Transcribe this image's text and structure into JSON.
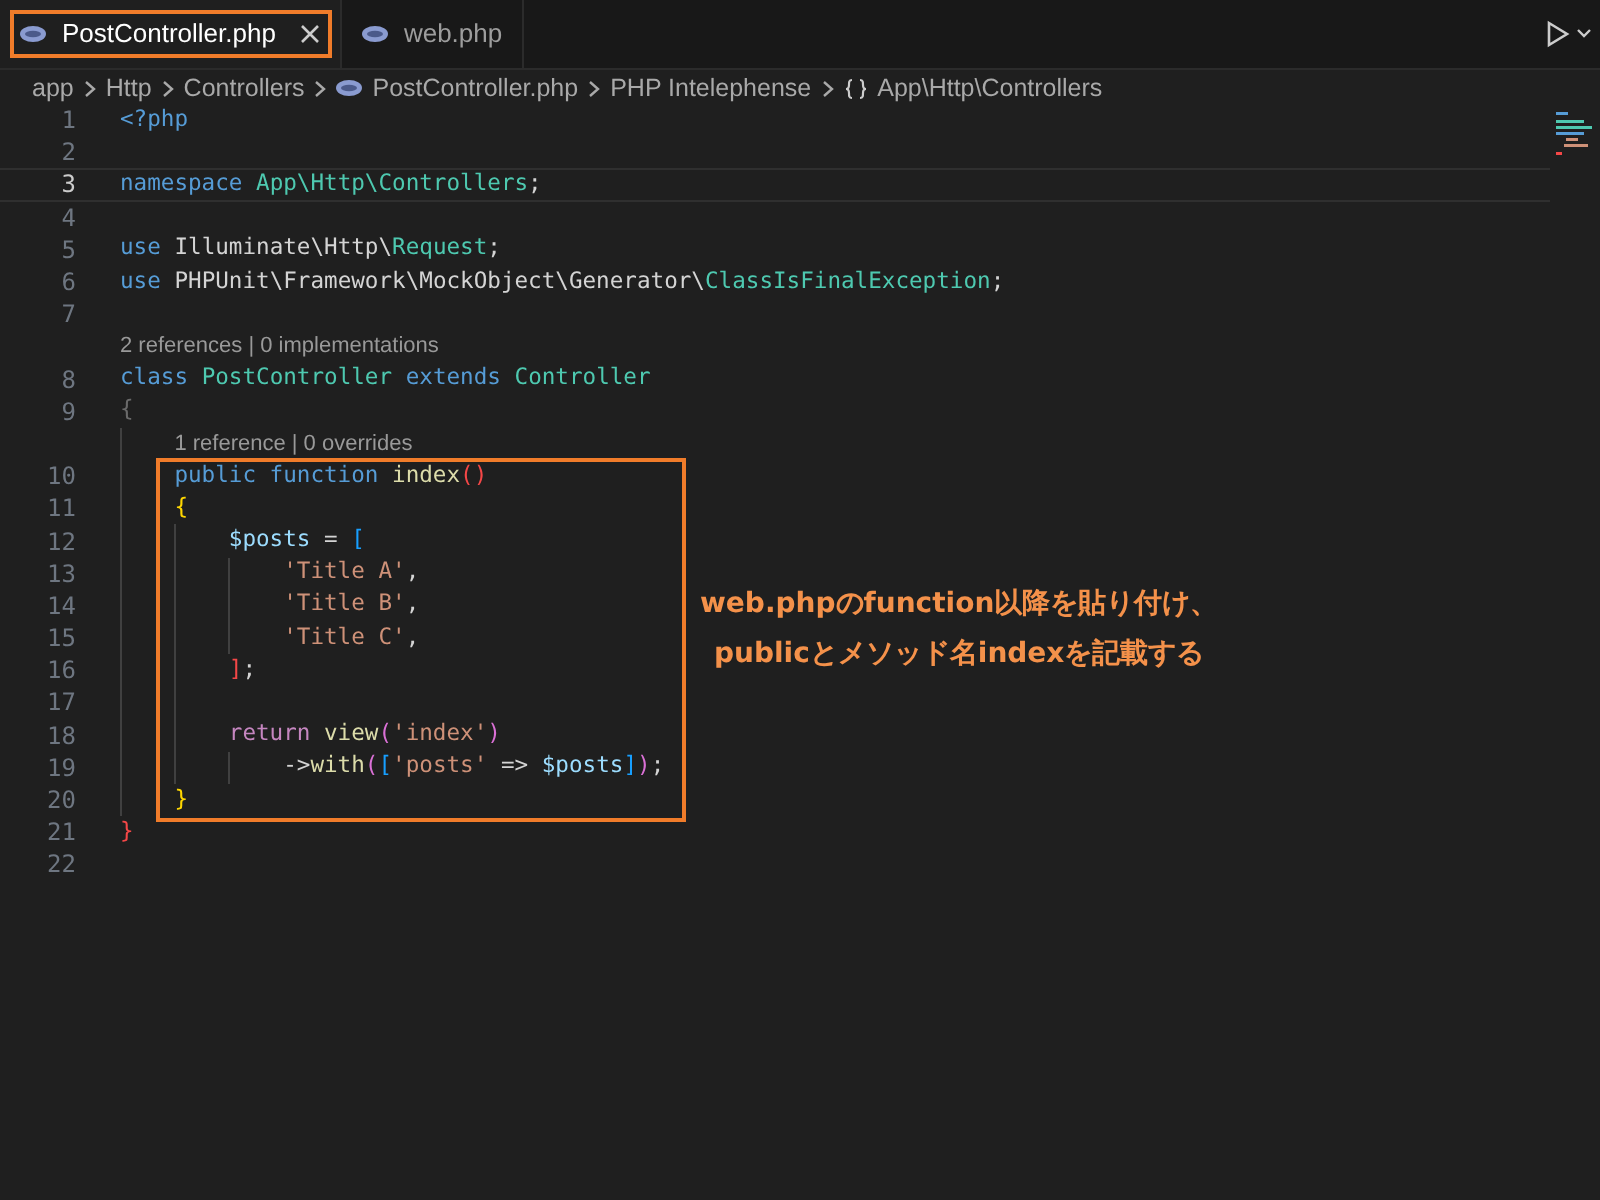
{
  "tabs": [
    {
      "label": "PostController.php",
      "selected": true
    },
    {
      "label": "web.php",
      "selected": false
    }
  ],
  "breadcrumb": [
    {
      "text": "app",
      "kind": "folder"
    },
    {
      "text": "Http",
      "kind": "folder"
    },
    {
      "text": "Controllers",
      "kind": "folder"
    },
    {
      "text": "PostController.php",
      "kind": "file"
    },
    {
      "text": "PHP Intelephense",
      "kind": "folder"
    },
    {
      "text": "App\\Http\\Controllers",
      "kind": "namespace"
    }
  ],
  "lines": [
    {
      "kind": "code",
      "number": "1",
      "tokens": [
        {
          "t": "<?php",
          "kind": "kw"
        }
      ]
    },
    {
      "kind": "code",
      "number": "2"
    },
    {
      "kind": "code",
      "number": "3",
      "current": true,
      "tokens": [
        {
          "t": "namespace ",
          "kind": "kw"
        },
        {
          "t": "App\\Http\\Controllers",
          "kind": "type"
        },
        {
          "t": ";",
          "kind": "plain"
        }
      ]
    },
    {
      "kind": "code",
      "number": "4"
    },
    {
      "kind": "code",
      "number": "5",
      "tokens": [
        {
          "t": "use ",
          "kind": "kw"
        },
        {
          "t": "Illuminate\\Http\\",
          "kind": "plain"
        },
        {
          "t": "Request",
          "kind": "type"
        },
        {
          "t": ";",
          "kind": "plain"
        }
      ]
    },
    {
      "kind": "code",
      "number": "6",
      "tokens": [
        {
          "t": "use ",
          "kind": "kw"
        },
        {
          "t": "PHPUnit\\Framework\\MockObject\\Generator\\",
          "kind": "plain"
        },
        {
          "t": "ClassIsFinalException",
          "kind": "type"
        },
        {
          "t": ";",
          "kind": "plain"
        }
      ]
    },
    {
      "kind": "code",
      "number": "7"
    },
    {
      "kind": "lens",
      "text": "2 references | 0 implementations"
    },
    {
      "kind": "code",
      "number": "8",
      "tokens": [
        {
          "t": "class ",
          "kind": "kw"
        },
        {
          "t": "PostController ",
          "kind": "type"
        },
        {
          "t": "extends ",
          "kind": "kw"
        },
        {
          "t": "Controller",
          "kind": "type"
        }
      ]
    },
    {
      "kind": "code",
      "number": "9",
      "tokens": [
        {
          "t": "{",
          "kind": "dim"
        }
      ],
      "children": [
        {
          "kind": "lens",
          "text": "1 reference | 0 overrides"
        },
        {
          "kind": "frame",
          "children": [
            {
              "kind": "code",
              "number": "10",
              "tokens": [
                {
                  "t": "public ",
                  "kind": "kw"
                },
                {
                  "t": "function ",
                  "kind": "kw"
                },
                {
                  "t": "index",
                  "kind": "fn"
                },
                {
                  "t": "()",
                  "kind": "red"
                }
              ]
            },
            {
              "kind": "code",
              "number": "11",
              "tokens": [
                {
                  "t": "{",
                  "kind": "gold"
                }
              ],
              "children": [
                {
                  "kind": "code",
                  "number": "12",
                  "tokens": [
                    {
                      "t": "$posts",
                      "kind": "var"
                    },
                    {
                      "t": " = ",
                      "kind": "plain"
                    },
                    {
                      "t": "[",
                      "kind": "blue"
                    }
                  ],
                  "children": [
                    {
                      "kind": "code",
                      "number": "13",
                      "tokens": [
                        {
                          "t": "'Title A'",
                          "kind": "str"
                        },
                        {
                          "t": ",",
                          "kind": "plain"
                        }
                      ]
                    },
                    {
                      "kind": "code",
                      "number": "14",
                      "tokens": [
                        {
                          "t": "'Title B'",
                          "kind": "str"
                        },
                        {
                          "t": ",",
                          "kind": "plain"
                        }
                      ]
                    },
                    {
                      "kind": "code",
                      "number": "15",
                      "tokens": [
                        {
                          "t": "'Title C'",
                          "kind": "str"
                        },
                        {
                          "t": ",",
                          "kind": "plain"
                        }
                      ]
                    }
                  ]
                },
                {
                  "kind": "code",
                  "number": "16",
                  "tokens": [
                    {
                      "t": "]",
                      "kind": "red"
                    },
                    {
                      "t": ";",
                      "kind": "plain"
                    }
                  ]
                },
                {
                  "kind": "code",
                  "number": "17"
                },
                {
                  "kind": "code",
                  "number": "18",
                  "tokens": [
                    {
                      "t": "return ",
                      "kind": "ctl"
                    },
                    {
                      "t": "view",
                      "kind": "fn"
                    },
                    {
                      "t": "(",
                      "kind": "purple"
                    },
                    {
                      "t": "'index'",
                      "kind": "str"
                    },
                    {
                      "t": ")",
                      "kind": "purple"
                    }
                  ],
                  "children": [
                    {
                      "kind": "code",
                      "number": "19",
                      "tokens": [
                        {
                          "t": "->",
                          "kind": "plain"
                        },
                        {
                          "t": "with",
                          "kind": "fn"
                        },
                        {
                          "t": "(",
                          "kind": "purple"
                        },
                        {
                          "t": "[",
                          "kind": "blue"
                        },
                        {
                          "t": "'posts'",
                          "kind": "str"
                        },
                        {
                          "t": " => ",
                          "kind": "plain"
                        },
                        {
                          "t": "$posts",
                          "kind": "var"
                        },
                        {
                          "t": "]",
                          "kind": "blue"
                        },
                        {
                          "t": ")",
                          "kind": "purple"
                        },
                        {
                          "t": ";",
                          "kind": "plain"
                        }
                      ]
                    }
                  ]
                }
              ]
            },
            {
              "kind": "code",
              "number": "20",
              "tokens": [
                {
                  "t": "}",
                  "kind": "gold"
                }
              ]
            }
          ]
        }
      ]
    },
    {
      "kind": "code",
      "number": "21",
      "tokens": [
        {
          "t": "}",
          "kind": "red"
        }
      ]
    },
    {
      "kind": "code",
      "number": "22"
    }
  ],
  "annotation": [
    "web.phpのfunction以降を貼り付け、",
    "publicとメソッド名indexを記載する"
  ]
}
